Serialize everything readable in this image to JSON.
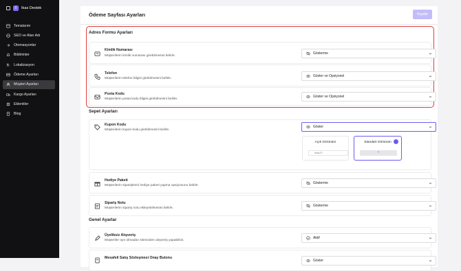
{
  "brand": {
    "name": "Ikas Destek",
    "logo_letter": "I"
  },
  "nav": {
    "items": [
      {
        "label": "Temalarım",
        "icon": "theme-icon"
      },
      {
        "label": "SEO ve Alan Adı",
        "icon": "globe-icon"
      },
      {
        "label": "Otomasyonlar",
        "icon": "automation-icon"
      },
      {
        "label": "Bildirimler",
        "icon": "bell-icon"
      },
      {
        "label": "Lokalizasyon",
        "icon": "language-icon"
      },
      {
        "label": "Ödeme Ayarları",
        "icon": "card-icon"
      },
      {
        "label": "Müşteri Ayarları",
        "icon": "users-icon",
        "active": true
      },
      {
        "label": "Kargo Ayarları",
        "icon": "truck-icon"
      },
      {
        "label": "Eklentiler",
        "icon": "plugin-icon"
      },
      {
        "label": "Blog",
        "icon": "blog-icon"
      }
    ]
  },
  "header": {
    "title": "Ödeme Sayfası Ayarları",
    "save_label": "Kaydet"
  },
  "address_section": {
    "title": "Adres Formu Ayarları",
    "rows": [
      {
        "title": "Kimlik Numarası",
        "desc": "Müşterilerin kimlik numarası girebilmesini belirle.",
        "value": "Gösterme",
        "value_icon": "eye-off-icon"
      },
      {
        "title": "Telefon",
        "desc": "Müşterilerin telefon bilgisi girebilmesini belirle.",
        "value": "Göster ve Opsiyonel",
        "value_icon": "eye-icon"
      },
      {
        "title": "Posta Kodu",
        "desc": "Müşterilerin posta kodu bilgisi girebilmesini belirle.",
        "value": "Göster ve Opsiyonel",
        "value_icon": "eye-icon"
      }
    ]
  },
  "cart_section": {
    "title": "Sepet Ayarları",
    "coupon": {
      "title": "Kupon Kodu",
      "desc": "Müşterilerin kupon kodu girebilmesini belirle.",
      "value": "Göster",
      "options": [
        {
          "label": "Açık Görünüm",
          "sample": "ikas20",
          "selected": false
        },
        {
          "label": "Standart Görünüm",
          "sample": "+",
          "selected": true
        }
      ]
    },
    "rows": [
      {
        "title": "Hediye Paketi",
        "desc": "Müşterilerin siparişlerini hediye paketi yapma opsiyonunu belirle.",
        "value": "Gösterme",
        "value_icon": "eye-off-icon"
      },
      {
        "title": "Sipariş Notu",
        "desc": "Müşterilerin sipariş notu ekleyebilmesini belirle.",
        "value": "Gösterme",
        "value_icon": "eye-off-icon"
      }
    ]
  },
  "general_section": {
    "title": "Genel Ayarlar",
    "rows": [
      {
        "title": "Üyeliksiz Alışveriş",
        "desc": "Müşteriler üye olmadan sitenizden alışveriş yapabilsin.",
        "value": "Aktif",
        "value_icon": "check-circle-icon"
      },
      {
        "title": "Mesafeli Satış Sözleşmesi Onay Butonu",
        "desc": "",
        "value": "Göster",
        "value_icon": "eye-icon"
      }
    ]
  },
  "colors": {
    "accent": "#6b5cf0",
    "highlight": "#e03a3a",
    "sidebar": "#111113"
  }
}
